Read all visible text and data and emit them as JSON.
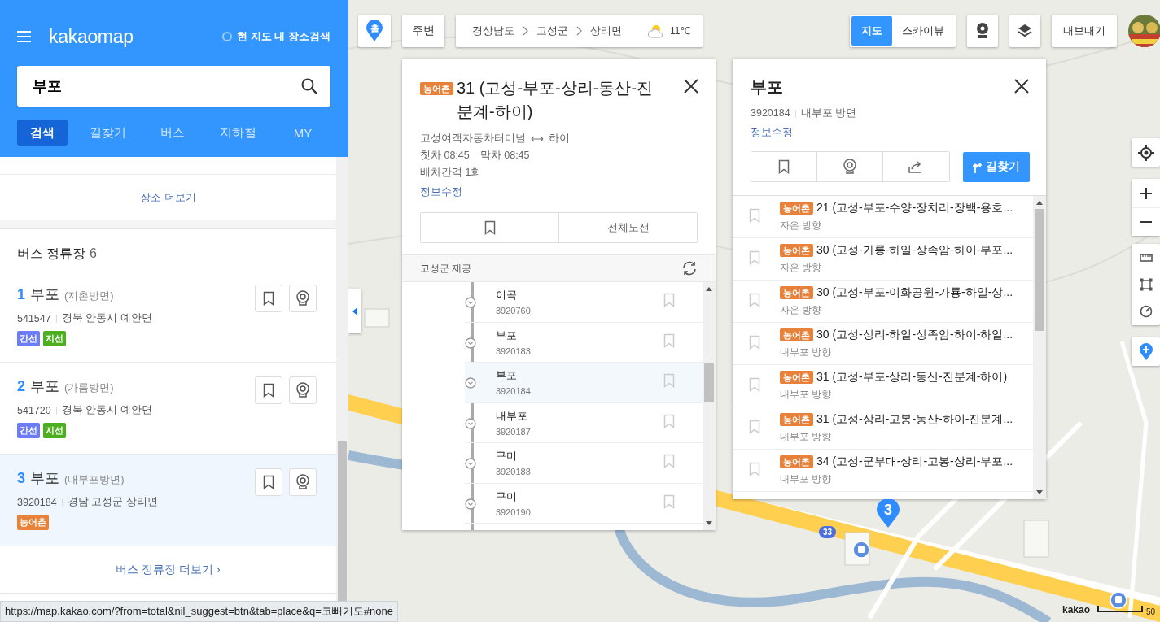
{
  "sidebar": {
    "logo": "kakaomap",
    "map_search_option": {
      "label": "현 지도 내 장소검색",
      "checked": false
    },
    "search": {
      "value": "부포"
    },
    "tabs": [
      {
        "label": "검색",
        "selected": true
      },
      {
        "label": "길찾기",
        "selected": false
      },
      {
        "label": "버스",
        "selected": false
      },
      {
        "label": "지하철",
        "selected": false
      },
      {
        "label": "MY",
        "selected": false
      }
    ],
    "more_places": "장소 더보기",
    "bus_stops": {
      "title": "버스 정류장",
      "count": "6",
      "items": [
        {
          "number": "1",
          "name": "부포",
          "direction": "(지촌방면)",
          "id": "541547",
          "address": "경북 안동시 예안면",
          "selected": false,
          "tags": [
            {
              "label": "간선",
              "color": "#6b7cf6"
            },
            {
              "label": "지선",
              "color": "#4caf1f"
            }
          ]
        },
        {
          "number": "2",
          "name": "부포",
          "direction": "(가름방면)",
          "id": "541720",
          "address": "경북 안동시 예안면",
          "selected": false,
          "tags": [
            {
              "label": "간선",
              "color": "#6b7cf6"
            },
            {
              "label": "지선",
              "color": "#4caf1f"
            }
          ]
        },
        {
          "number": "3",
          "name": "부포",
          "direction": "(내부포방면)",
          "id": "3920184",
          "address": "경남 고성군 상리면",
          "selected": true,
          "tags": [
            {
              "label": "농어촌",
              "color": "#e8823a"
            }
          ]
        }
      ],
      "more": "버스 정류장 더보기 ›"
    }
  },
  "status_url": "https://map.kakao.com/?from=total&nil_suggest=btn&tab=place&q=코빼기도#none",
  "map": {
    "start_pin": "출",
    "nearby": "주변",
    "breadcrumb": [
      "경상남도",
      "고성군",
      "상리면"
    ],
    "temperature": "11℃",
    "view_modes": [
      {
        "label": "지도",
        "selected": true
      },
      {
        "label": "스카이뷰",
        "selected": false
      }
    ],
    "export": "내보내기",
    "marker": "3",
    "route_badge": "33",
    "attribution": "kakao",
    "scale": "50"
  },
  "route_panel": {
    "badge": "농어촌",
    "title": "31 (고성-부포-상리-동산-진분계-하이)",
    "origin": "고성여객자동차터미널",
    "destination": "하이",
    "first_bus": "첫차 08:45",
    "last_bus": "막차 08:45",
    "interval": "배차간격 1회",
    "edit": "정보수정",
    "all_routes": "전체노선",
    "provider": "고성군 제공",
    "stops": [
      {
        "name": "이곡",
        "id": "3920760",
        "selected": false
      },
      {
        "name": "부포",
        "id": "3920183",
        "selected": false
      },
      {
        "name": "부포",
        "id": "3920184",
        "selected": true
      },
      {
        "name": "내부포",
        "id": "3920187",
        "selected": false
      },
      {
        "name": "구미",
        "id": "3920188",
        "selected": false
      },
      {
        "name": "구미",
        "id": "3920190",
        "selected": false
      }
    ]
  },
  "stop_panel": {
    "title": "부포",
    "id": "3920184",
    "direction": "내부포 방면",
    "edit": "정보수정",
    "directions": "길찾기",
    "routes": [
      {
        "badge": "농어촌",
        "name": "21 (고성-부포-수양-장치리-장백-용호...",
        "direction": "자은 방향"
      },
      {
        "badge": "농어촌",
        "name": "30 (고성-가룡-하일-상족암-하이-부포...",
        "direction": "자은 방향"
      },
      {
        "badge": "농어촌",
        "name": "30 (고성-부포-이화공원-가룡-하일-상...",
        "direction": "자은 방향"
      },
      {
        "badge": "농어촌",
        "name": "30 (고성-상리-하일-상족암-하이-하일...",
        "direction": "내부포 방향"
      },
      {
        "badge": "농어촌",
        "name": "31 (고성-부포-상리-동산-진분계-하이)",
        "direction": "내부포 방향"
      },
      {
        "badge": "농어촌",
        "name": "31 (고성-상리-고봉-동산-하이-진분계...",
        "direction": "내부포 방향"
      },
      {
        "badge": "농어촌",
        "name": "34 (고성-군부대-상리-고봉-상리-부포...",
        "direction": "내부포 방향"
      }
    ]
  }
}
